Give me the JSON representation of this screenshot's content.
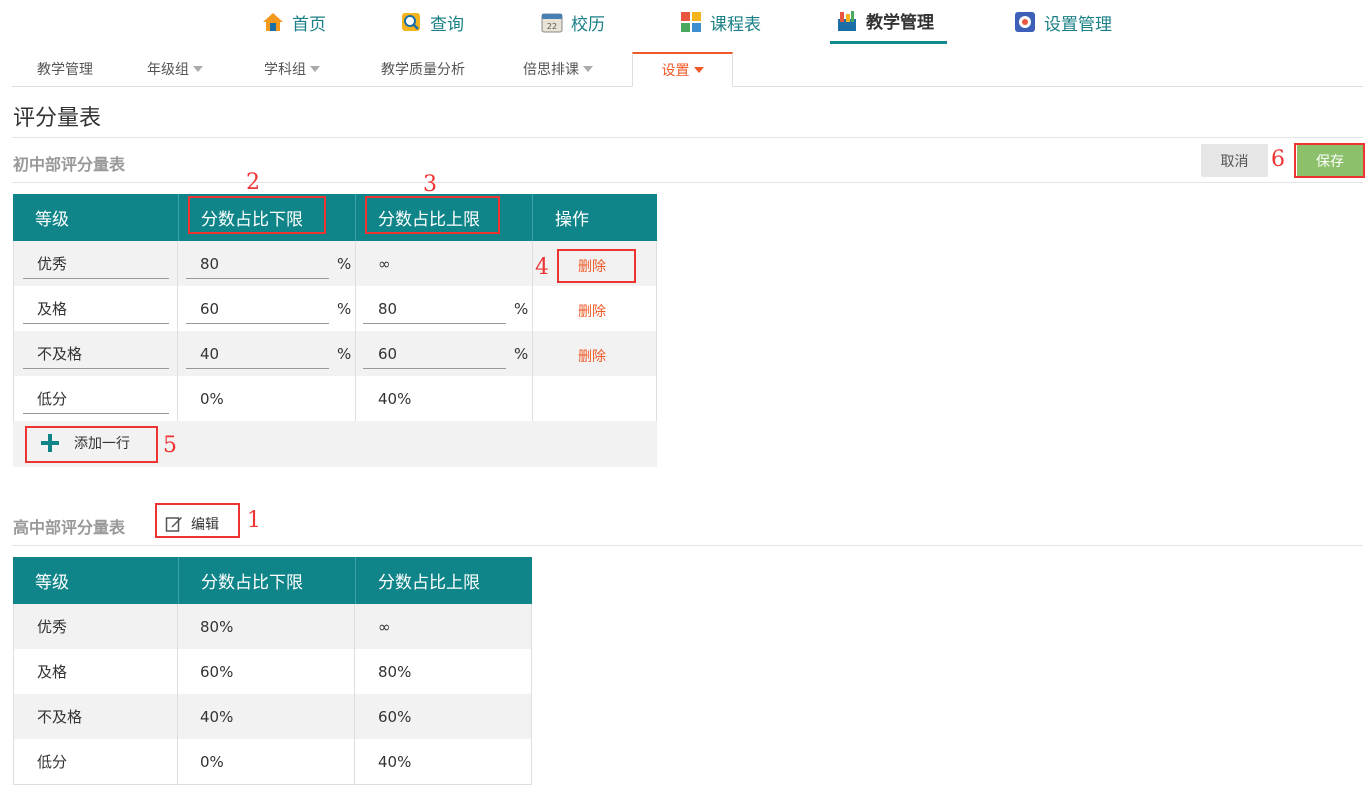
{
  "topnav": [
    {
      "label": "首页",
      "icon": "home-icon"
    },
    {
      "label": "查询",
      "icon": "search-icon"
    },
    {
      "label": "校历",
      "icon": "calendar-icon"
    },
    {
      "label": "课程表",
      "icon": "timetable-icon"
    },
    {
      "label": "教学管理",
      "icon": "teaching-icon",
      "active": true
    },
    {
      "label": "设置管理",
      "icon": "settings-icon"
    }
  ],
  "subtabs": [
    {
      "label": "教学管理"
    },
    {
      "label": "年级组"
    },
    {
      "label": "学科组"
    },
    {
      "label": "教学质量分析"
    },
    {
      "label": "倍思排课"
    },
    {
      "label": "设置",
      "active": true
    }
  ],
  "page_title": "评分量表",
  "section1": {
    "title": "初中部评分量表",
    "cancel_label": "取消",
    "save_label": "保存",
    "headers": [
      "等级",
      "分数占比下限",
      "分数占比上限",
      "操作"
    ],
    "rows": [
      {
        "grade": "优秀",
        "lower": "80",
        "upper": "∞",
        "action": "删除"
      },
      {
        "grade": "及格",
        "lower": "60",
        "upper": "80",
        "action": "删除"
      },
      {
        "grade": "不及格",
        "lower": "40",
        "upper": "60",
        "action": "删除"
      },
      {
        "grade": "低分",
        "lower": "0%",
        "upper": "40%",
        "action": ""
      }
    ],
    "percent": "%",
    "add_row_label": "添加一行"
  },
  "section2": {
    "title": "高中部评分量表",
    "edit_label": "编辑",
    "headers": [
      "等级",
      "分数占比下限",
      "分数占比上限"
    ],
    "rows": [
      {
        "grade": "优秀",
        "lower": "80%",
        "upper": "∞"
      },
      {
        "grade": "及格",
        "lower": "60%",
        "upper": "80%"
      },
      {
        "grade": "不及格",
        "lower": "40%",
        "upper": "60%"
      },
      {
        "grade": "低分",
        "lower": "0%",
        "upper": "40%"
      }
    ]
  },
  "annotations": [
    "1",
    "2",
    "3",
    "4",
    "5",
    "6"
  ],
  "colors": {
    "header_bg": "#0f858a",
    "accent": "#f05a28",
    "save": "#8cc06a",
    "annotation": "#e33"
  }
}
